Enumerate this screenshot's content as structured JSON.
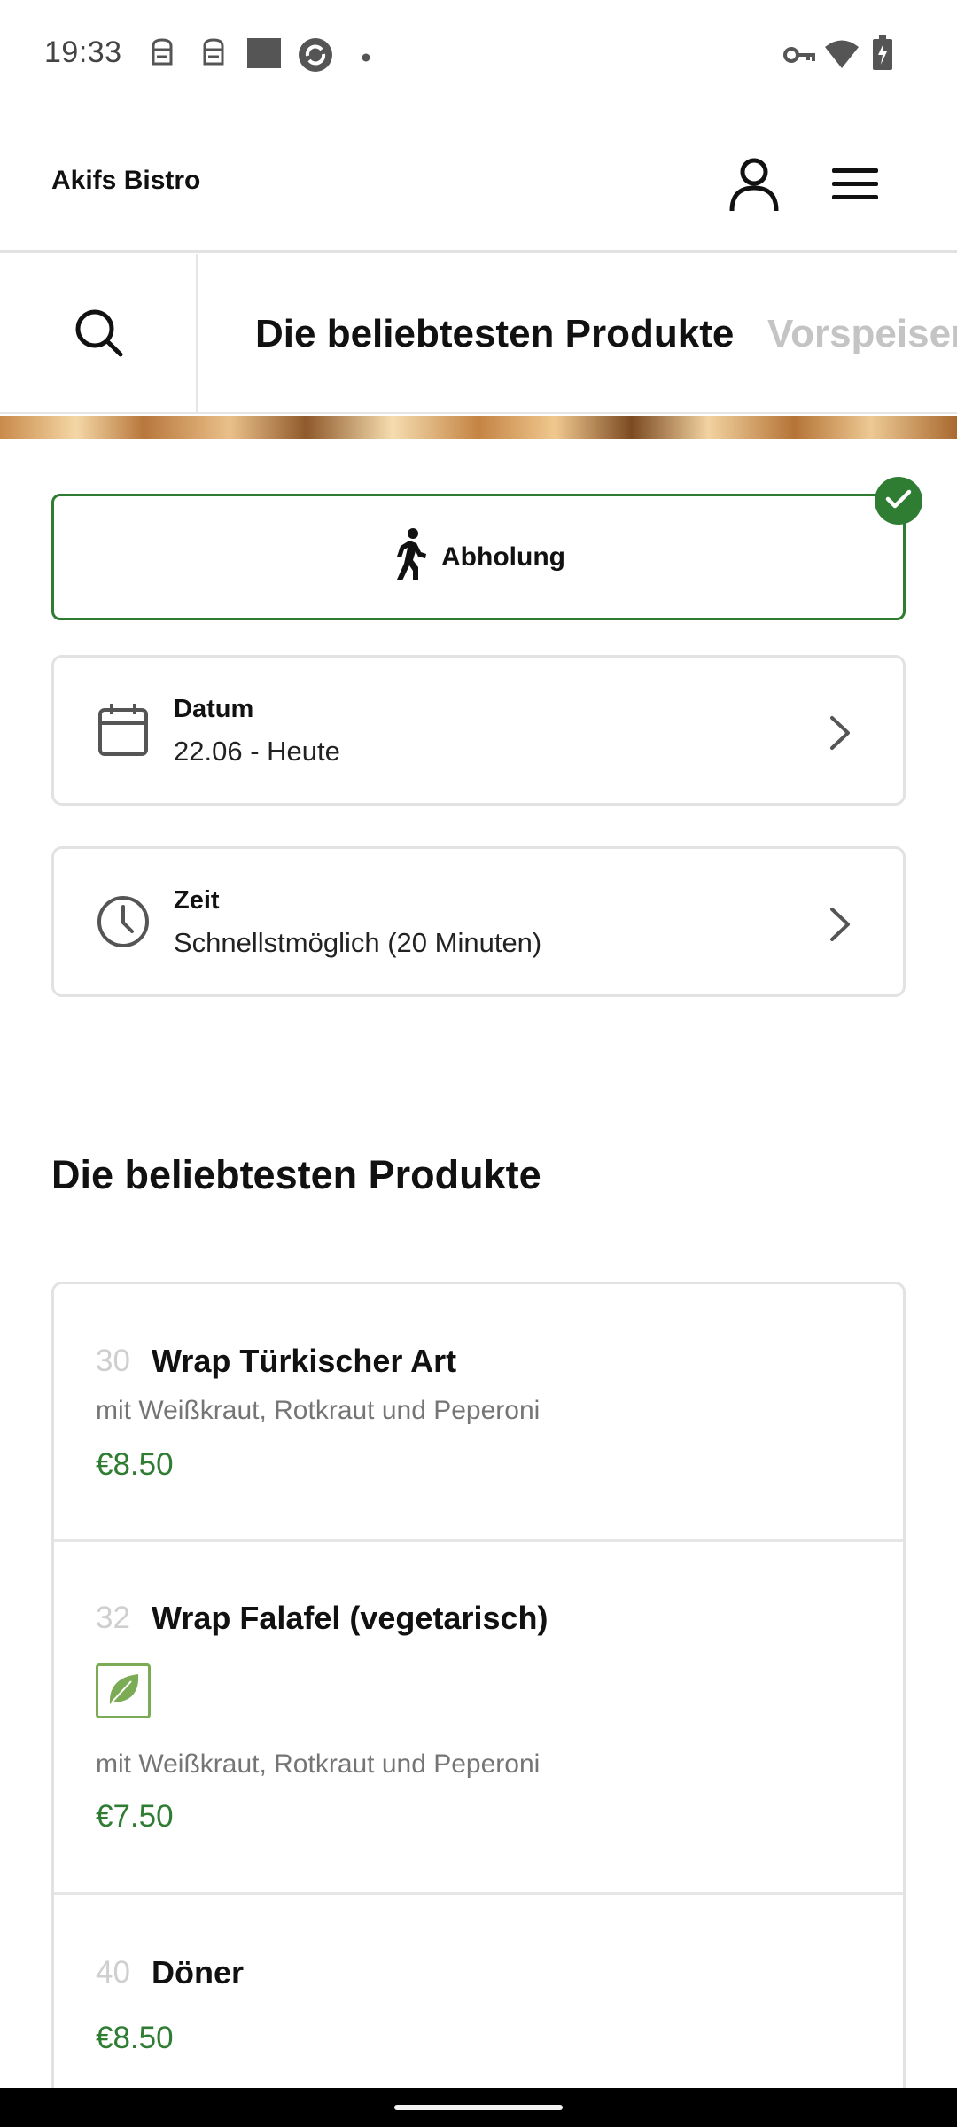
{
  "status_bar": {
    "time": "19:33",
    "icons": [
      "notification-icon",
      "notification-icon",
      "image-icon",
      "sync-icon",
      "dot-icon",
      "vpn-key-icon",
      "wifi-icon",
      "battery-charging-icon"
    ]
  },
  "header": {
    "brand": "Akifs Bistro",
    "icons": [
      "user-icon",
      "menu-icon"
    ]
  },
  "category_bar": {
    "tabs": [
      {
        "label": "Die beliebtesten Produkte",
        "active": true
      },
      {
        "label": "Vorspeisen",
        "active": false
      }
    ]
  },
  "pickup": {
    "label": "Abholung",
    "selected": true
  },
  "date": {
    "title": "Datum",
    "value": "22.06 - Heute"
  },
  "time_slot": {
    "title": "Zeit",
    "value": "Schnellstmöglich (20 Minuten)"
  },
  "section": {
    "title": "Die beliebtesten Produkte"
  },
  "products": [
    {
      "number": "30",
      "name": "Wrap Türkischer Art",
      "description": "mit Weißkraut, Rotkraut und Peperoni",
      "price": "€8.50",
      "vegetarian": false
    },
    {
      "number": "32",
      "name": "Wrap Falafel (vegetarisch)",
      "description": "mit Weißkraut, Rotkraut und Peperoni",
      "price": "€7.50",
      "vegetarian": true
    },
    {
      "number": "40",
      "name": "Döner",
      "description": "",
      "price": "€8.50",
      "vegetarian": false
    }
  ],
  "colors": {
    "accent_green": "#2e7d32",
    "veg_green": "#7cab55",
    "border_gray": "#e2e2e2",
    "inactive_tab": "#c4c4c4"
  }
}
